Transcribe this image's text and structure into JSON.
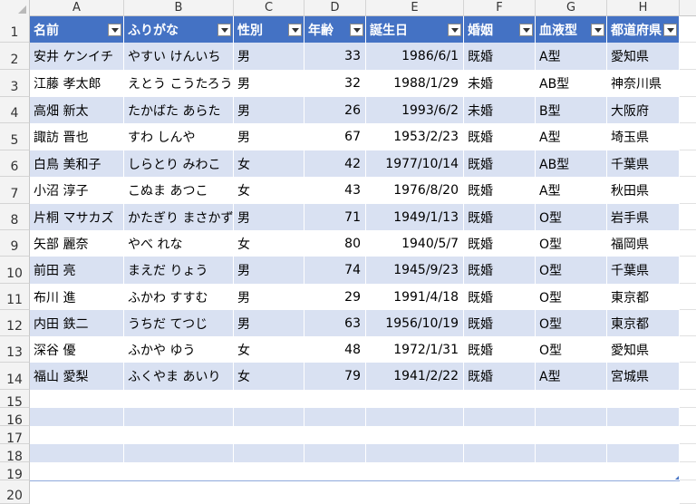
{
  "columns": [
    "A",
    "B",
    "C",
    "D",
    "E",
    "F",
    "G",
    "H"
  ],
  "header": [
    "名前",
    "ふりがな",
    "性別",
    "年齢",
    "誕生日",
    "婚姻",
    "血液型",
    "都道府県"
  ],
  "rows": [
    [
      "安井 ケンイチ",
      "やすい けんいち",
      "男",
      "33",
      "1986/6/1",
      "既婚",
      "A型",
      "愛知県"
    ],
    [
      "江藤 孝太郎",
      "えとう こうたろう",
      "男",
      "32",
      "1988/1/29",
      "未婚",
      "AB型",
      "神奈川県"
    ],
    [
      "高畑 新太",
      "たかばた あらた",
      "男",
      "26",
      "1993/6/2",
      "未婚",
      "B型",
      "大阪府"
    ],
    [
      "諏訪 晋也",
      "すわ しんや",
      "男",
      "67",
      "1953/2/23",
      "既婚",
      "A型",
      "埼玉県"
    ],
    [
      "白鳥 美和子",
      "しらとり みわこ",
      "女",
      "42",
      "1977/10/14",
      "既婚",
      "AB型",
      "千葉県"
    ],
    [
      "小沼 淳子",
      "こぬま あつこ",
      "女",
      "43",
      "1976/8/20",
      "既婚",
      "A型",
      "秋田県"
    ],
    [
      "片桐 マサカズ",
      "かたぎり まさかず",
      "男",
      "71",
      "1949/1/13",
      "既婚",
      "O型",
      "岩手県"
    ],
    [
      "矢部 麗奈",
      "やべ れな",
      "女",
      "80",
      "1940/5/7",
      "既婚",
      "O型",
      "福岡県"
    ],
    [
      "前田 亮",
      "まえだ りょう",
      "男",
      "74",
      "1945/9/23",
      "既婚",
      "O型",
      "千葉県"
    ],
    [
      "布川 進",
      "ふかわ すすむ",
      "男",
      "29",
      "1991/4/18",
      "既婚",
      "O型",
      "東京都"
    ],
    [
      "内田 鉄二",
      "うちだ てつじ",
      "男",
      "63",
      "1956/10/19",
      "既婚",
      "O型",
      "東京都"
    ],
    [
      "深谷 優",
      "ふかや ゆう",
      "女",
      "48",
      "1972/1/31",
      "既婚",
      "O型",
      "愛知県"
    ],
    [
      "福山 愛梨",
      "ふくやま あいり",
      "女",
      "79",
      "1941/2/22",
      "既婚",
      "A型",
      "宮城県"
    ]
  ],
  "row_numbers": [
    "1",
    "2",
    "3",
    "4",
    "5",
    "6",
    "7",
    "8",
    "9",
    "10",
    "11",
    "12",
    "13",
    "14",
    "15",
    "16",
    "17",
    "18",
    "19",
    "20"
  ],
  "colors": {
    "header_fill": "#4472c4",
    "band_fill": "#d9e1f2"
  }
}
